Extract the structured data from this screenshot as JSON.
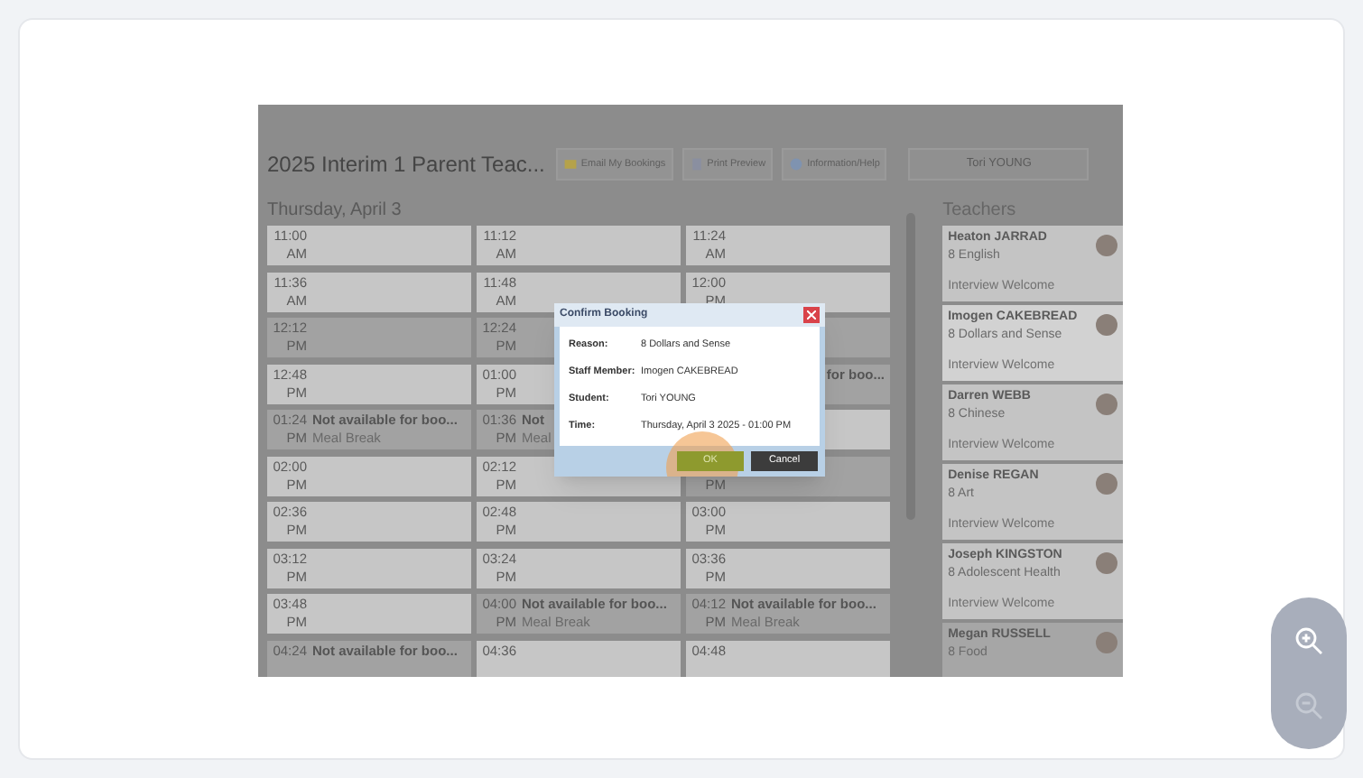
{
  "app": {
    "title": "2025 Interim 1 Parent Teac...",
    "toolbar": [
      {
        "label": "Email My Bookings"
      },
      {
        "label": "Print Preview"
      },
      {
        "label": "Information/Help"
      }
    ],
    "student_field": "Tori YOUNG",
    "date": "Thursday, April 3"
  },
  "slots": [
    [
      {
        "kind": "open",
        "time": "11:00",
        "period": "AM"
      },
      {
        "kind": "open",
        "time": "11:12",
        "period": "AM"
      },
      {
        "kind": "open",
        "time": "11:24",
        "period": "AM"
      }
    ],
    [
      {
        "kind": "open",
        "time": "11:36",
        "period": "AM"
      },
      {
        "kind": "open",
        "time": "11:48",
        "period": "AM"
      },
      {
        "kind": "open",
        "time": "12:00",
        "period": "PM"
      }
    ],
    [
      {
        "kind": "unavailable",
        "time": "12:12",
        "period": "PM"
      },
      {
        "kind": "unavailable",
        "time": "12:24",
        "period": "PM"
      },
      {
        "kind": "unavailable"
      }
    ],
    [
      {
        "kind": "open",
        "time": "12:48",
        "period": "PM"
      },
      {
        "kind": "open",
        "time": "01:00",
        "period": "PM"
      },
      {
        "kind": "unavailable",
        "title": "for boo..."
      }
    ],
    [
      {
        "kind": "unavailable",
        "time": "01:24",
        "period": "PM",
        "title": "Not available for boo...",
        "note": "Meal Break"
      },
      {
        "kind": "unavailable",
        "time": "01:36",
        "period": "PM",
        "title": "Not",
        "note": "Meal"
      },
      {
        "kind": "open"
      }
    ],
    [
      {
        "kind": "open",
        "time": "02:00",
        "period": "PM"
      },
      {
        "kind": "open",
        "time": "02:12",
        "period": "PM"
      },
      {
        "kind": "unavailable",
        "period": "PM"
      }
    ],
    [
      {
        "kind": "open",
        "time": "02:36",
        "period": "PM"
      },
      {
        "kind": "open",
        "time": "02:48",
        "period": "PM"
      },
      {
        "kind": "open",
        "time": "03:00",
        "period": "PM"
      }
    ],
    [
      {
        "kind": "open",
        "time": "03:12",
        "period": "PM"
      },
      {
        "kind": "open",
        "time": "03:24",
        "period": "PM"
      },
      {
        "kind": "open",
        "time": "03:36",
        "period": "PM"
      }
    ],
    [
      {
        "kind": "open",
        "time": "03:48",
        "period": "PM"
      },
      {
        "kind": "unavailable",
        "time": "04:00",
        "period": "PM",
        "title": "Not available for boo...",
        "note": "Meal Break"
      },
      {
        "kind": "unavailable",
        "time": "04:12",
        "period": "PM",
        "title": "Not available for boo...",
        "note": "Meal Break"
      }
    ],
    [
      {
        "kind": "unavailable",
        "time": "04:24",
        "title": "Not available for boo..."
      },
      {
        "kind": "open",
        "time": "04:36"
      },
      {
        "kind": "open",
        "time": "04:48"
      }
    ]
  ],
  "teachers": {
    "heading": "Teachers",
    "items": [
      {
        "name": "Heaton JARRAD",
        "subject": "8 English",
        "status": "Interview Welcome",
        "selected": false,
        "dimmed": false
      },
      {
        "name": "Imogen CAKEBREAD",
        "subject": "8 Dollars and Sense",
        "status": "Interview Welcome",
        "selected": true,
        "dimmed": false
      },
      {
        "name": "Darren WEBB",
        "subject": "8 Chinese",
        "status": "Interview Welcome",
        "selected": false,
        "dimmed": false
      },
      {
        "name": "Denise REGAN",
        "subject": "8 Art",
        "status": "Interview Welcome",
        "selected": false,
        "dimmed": false
      },
      {
        "name": "Joseph KINGSTON",
        "subject": "8 Adolescent Health",
        "status": "Interview Welcome",
        "selected": false,
        "dimmed": false
      },
      {
        "name": "Megan RUSSELL",
        "subject": "8 Food",
        "selected": false,
        "dimmed": true
      }
    ]
  },
  "dialog": {
    "title": "Confirm Booking",
    "fields": [
      {
        "label": "Reason:",
        "value": "8 Dollars and Sense"
      },
      {
        "label": "Staff Member:",
        "value": "Imogen CAKEBREAD"
      },
      {
        "label": "Student:",
        "value": "Tori YOUNG"
      },
      {
        "label": "Time:",
        "value": "Thursday, April 3 2025 - 01:00 PM"
      }
    ],
    "ok": "OK",
    "cancel": "Cancel",
    "ok_highlighted": true
  }
}
